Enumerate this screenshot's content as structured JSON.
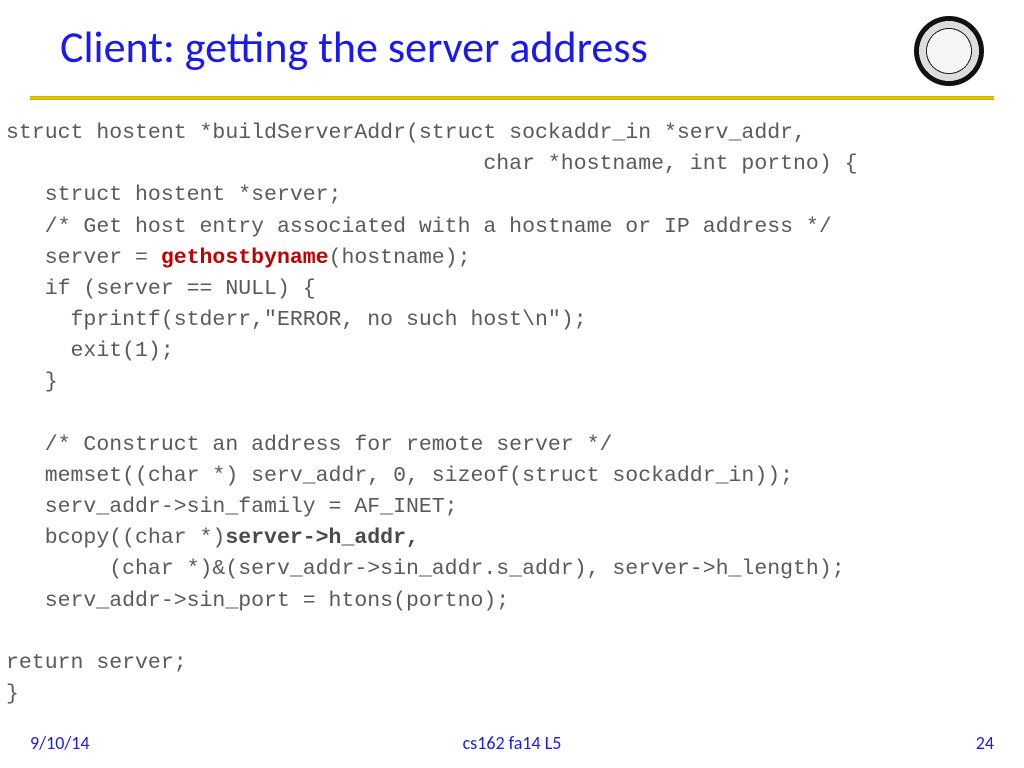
{
  "title": "Client: getting the server address",
  "footer": {
    "left": "9/10/14",
    "center": "cs162 fa14 L5",
    "right": "24"
  },
  "code": {
    "l01a": "struct hostent *buildServerAddr(struct sockaddr_in *serv_addr,",
    "l02a": "                                     char *hostname, int portno) {",
    "l03a": "   struct hostent *server;",
    "l04a": "   /* Get host entry associated with a hostname or IP address */",
    "l05a": "   server = ",
    "l05b": "gethostbyname",
    "l05c": "(hostname);",
    "l06a": "   if (server == NULL) {",
    "l07a": "     fprintf(stderr,\"ERROR, no such host\\n\");",
    "l08a": "     exit(1);",
    "l09a": "   }",
    "l10a": "",
    "l11a": "   /* Construct an address for remote server */",
    "l12a": "   memset((char *) serv_addr, 0, sizeof(struct sockaddr_in));",
    "l13a": "   serv_addr->sin_family = AF_INET;",
    "l14a": "   bcopy((char *)",
    "l14b": "server->h_addr,",
    "l15a": "        (char *)&(serv_addr->sin_addr.s_addr), server->h_length);",
    "l16a": "   serv_addr->sin_port = htons(portno);",
    "l17a": "",
    "l18a": "return server;",
    "l19a": "}"
  }
}
